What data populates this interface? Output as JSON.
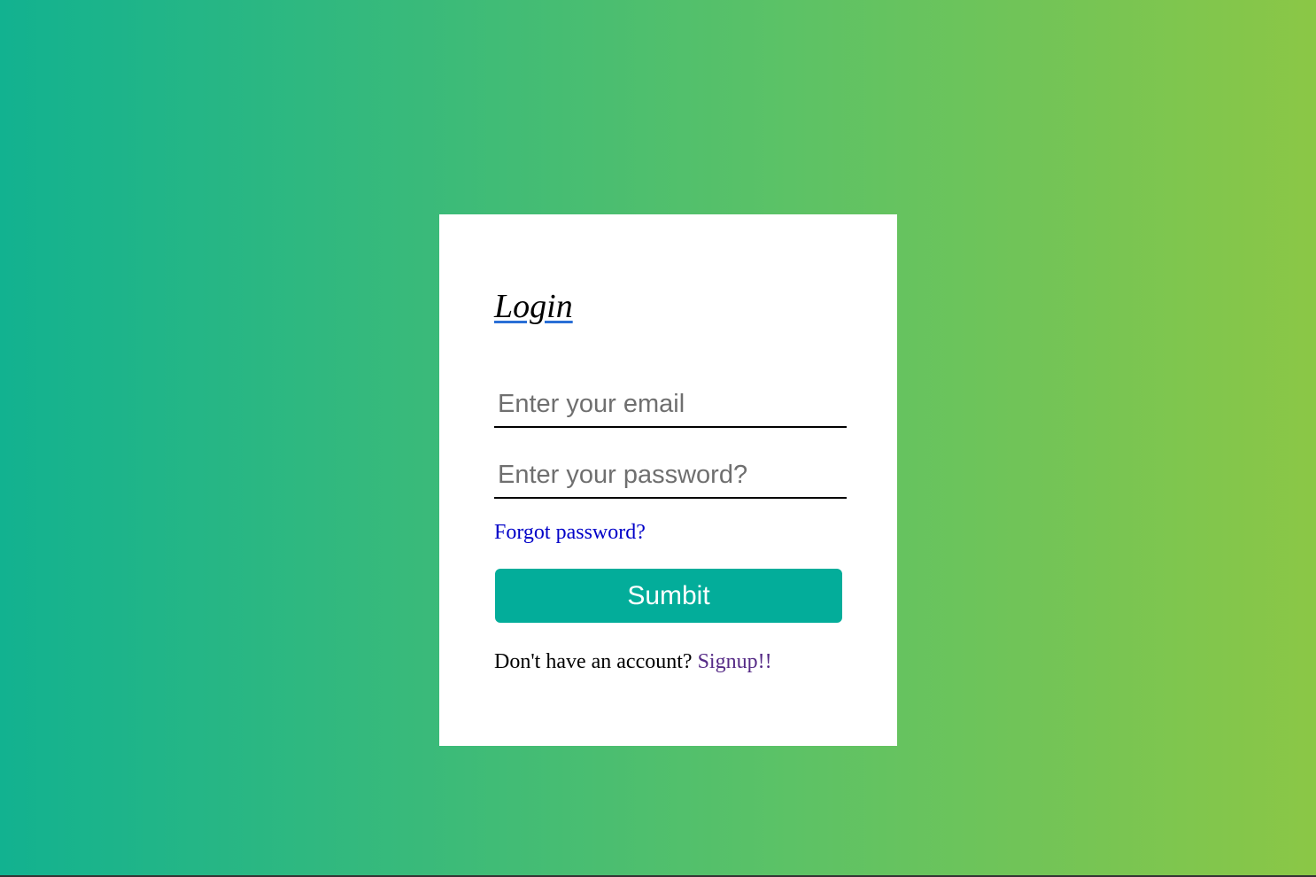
{
  "login": {
    "title": "Login",
    "email_placeholder": "Enter your email",
    "password_placeholder": "Enter your password?",
    "forgot_label": "Forgot password?",
    "submit_label": "Sumbit",
    "no_account_text": "Don't have an account?",
    "signup_label": "Signup!!"
  },
  "colors": {
    "accent": "#03ad9a",
    "gradient_start": "#12b290",
    "gradient_end": "#8bc746"
  }
}
